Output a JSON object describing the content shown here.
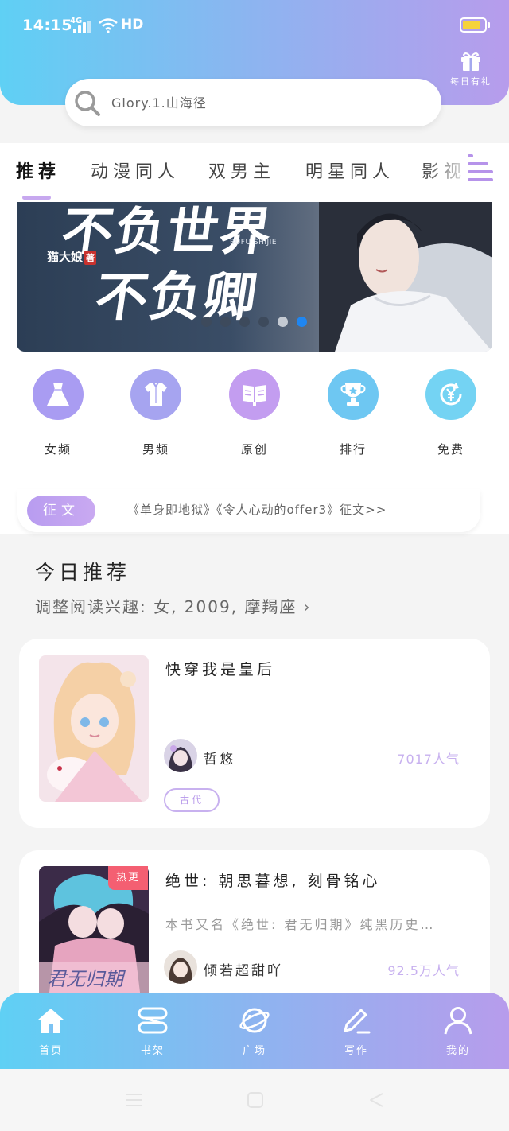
{
  "status_bar": {
    "time": "14:15",
    "network": "4G",
    "hd": "HD"
  },
  "header": {
    "gift_label": "每日有礼",
    "search_placeholder": "Glory.1.山海径"
  },
  "tabs": [
    {
      "label": "推荐",
      "active": true
    },
    {
      "label": "动漫同人"
    },
    {
      "label": "双男主"
    },
    {
      "label": "明星同人"
    },
    {
      "label": "影视"
    }
  ],
  "banner": {
    "title_line1": "不负世界",
    "title_line2": "不负卿",
    "author": "猫大娘",
    "author_suffix": "著",
    "small_text": "BUFU SHIJIE",
    "dots": 6,
    "active_dot": 5
  },
  "categories": [
    {
      "label": "女频",
      "icon": "dress-icon",
      "color": "#a99cf2"
    },
    {
      "label": "男频",
      "icon": "shirt-icon",
      "color": "#a6a4f0"
    },
    {
      "label": "原创",
      "icon": "book-icon",
      "color": "#c39df0"
    },
    {
      "label": "排行",
      "icon": "trophy-icon",
      "color": "#6ec7f2"
    },
    {
      "label": "免费",
      "icon": "yen-icon",
      "color": "#74d3f3"
    }
  ],
  "essay": {
    "badge": "征文",
    "text": "《单身即地狱》《令人心动的offer3》征文>>"
  },
  "today": {
    "title": "今日推荐",
    "subtitle": "调整阅读兴趣: 女, 2009, 摩羯座"
  },
  "books": [
    {
      "title": "快穿我是皇后",
      "description": "",
      "author": "哲悠",
      "popularity": "7017人气",
      "tag": "古代",
      "hot": ""
    },
    {
      "title": "绝世: 朝思暮想, 刻骨铭心",
      "description": "本书又名《绝世: 君无归期》纯黑历史…",
      "author": "倾若超甜吖",
      "popularity": "92.5万人气",
      "tag": "",
      "hot": "热更"
    }
  ],
  "bottom_nav": [
    {
      "label": "首页",
      "icon": "home-icon"
    },
    {
      "label": "书架",
      "icon": "bookshelf-icon"
    },
    {
      "label": "广场",
      "icon": "planet-icon"
    },
    {
      "label": "写作",
      "icon": "pen-icon"
    },
    {
      "label": "我的",
      "icon": "user-icon"
    }
  ],
  "colors": {
    "gradient_start": "#5fd0f4",
    "gradient_end": "#b79cec",
    "accent": "#c7a8ef",
    "hot": "#f45f72"
  }
}
